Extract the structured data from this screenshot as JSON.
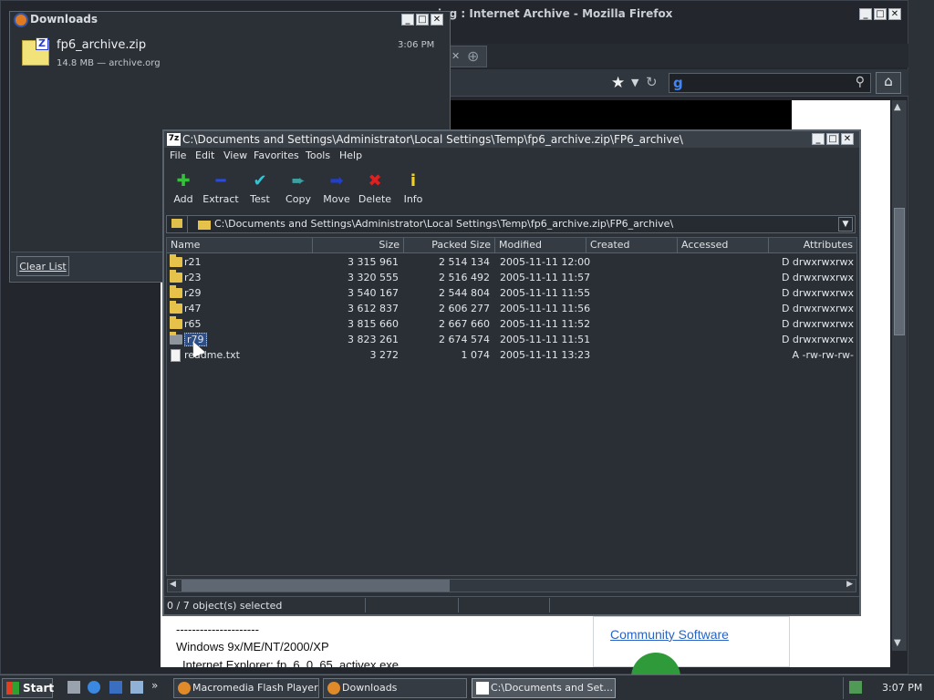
{
  "firefox": {
    "title": "ing : Internet Archive - Mozilla Firefox",
    "page": {
      "dashes": "---------------------",
      "os_line": "Windows 9x/ME/NT/2000/XP",
      "ie_line": "Internet Explorer: fp_6_0_65_activex.exe",
      "community_link": "Community Software"
    }
  },
  "downloads": {
    "title": "Downloads",
    "item": {
      "filename": "fp6_archive.zip",
      "details": "14.8 MB — archive.org",
      "time": "3:06 PM"
    },
    "clear_list": "Clear List"
  },
  "sevenzip": {
    "title": "C:\\Documents and Settings\\Administrator\\Local Settings\\Temp\\fp6_archive.zip\\FP6_archive\\",
    "menu": [
      "File",
      "Edit",
      "View",
      "Favorites",
      "Tools",
      "Help"
    ],
    "toolbar": [
      {
        "label": "Add",
        "icon": "plus-icon",
        "glyph": "✚",
        "color": "#35c23a"
      },
      {
        "label": "Extract",
        "icon": "minus-icon",
        "glyph": "━",
        "color": "#2a4ae0"
      },
      {
        "label": "Test",
        "icon": "check-icon",
        "glyph": "✔",
        "color": "#2ec7d8"
      },
      {
        "label": "Copy",
        "icon": "copy-arrow-icon",
        "glyph": "➨",
        "color": "#3aa0a0"
      },
      {
        "label": "Move",
        "icon": "move-arrow-icon",
        "glyph": "➡",
        "color": "#1f3fd0"
      },
      {
        "label": "Delete",
        "icon": "delete-x-icon",
        "glyph": "✖",
        "color": "#e02020"
      },
      {
        "label": "Info",
        "icon": "info-icon",
        "glyph": "i",
        "color": "#f2d21e"
      }
    ],
    "address": "C:\\Documents and Settings\\Administrator\\Local Settings\\Temp\\fp6_archive.zip\\FP6_archive\\",
    "columns": [
      "Name",
      "Size",
      "Packed Size",
      "Modified",
      "Created",
      "Accessed",
      "Attributes"
    ],
    "rows": [
      {
        "name": "r21",
        "size": "3 315 961",
        "packed": "2 514 134",
        "modified": "2005-11-11 12:00",
        "attr": "D drwxrwxrwx",
        "type": "folder"
      },
      {
        "name": "r23",
        "size": "3 320 555",
        "packed": "2 516 492",
        "modified": "2005-11-11 11:57",
        "attr": "D drwxrwxrwx",
        "type": "folder"
      },
      {
        "name": "r29",
        "size": "3 540 167",
        "packed": "2 544 804",
        "modified": "2005-11-11 11:55",
        "attr": "D drwxrwxrwx",
        "type": "folder"
      },
      {
        "name": "r47",
        "size": "3 612 837",
        "packed": "2 606 277",
        "modified": "2005-11-11 11:56",
        "attr": "D drwxrwxrwx",
        "type": "folder"
      },
      {
        "name": "r65",
        "size": "3 815 660",
        "packed": "2 667 660",
        "modified": "2005-11-11 11:52",
        "attr": "D drwxrwxrwx",
        "type": "folder"
      },
      {
        "name": "r79",
        "size": "3 823 261",
        "packed": "2 674 574",
        "modified": "2005-11-11 11:51",
        "attr": "D drwxrwxrwx",
        "type": "folder"
      },
      {
        "name": "readme.txt",
        "size": "3 272",
        "packed": "1 074",
        "modified": "2005-11-11 13:23",
        "attr": "A -rw-rw-rw-",
        "type": "file"
      }
    ],
    "status": "0 / 7 object(s) selected"
  },
  "taskbar": {
    "start": "Start",
    "tasks": [
      "Macromedia Flash Player ...",
      "Downloads",
      "C:\\Documents and Set..."
    ],
    "clock": "3:07 PM"
  }
}
